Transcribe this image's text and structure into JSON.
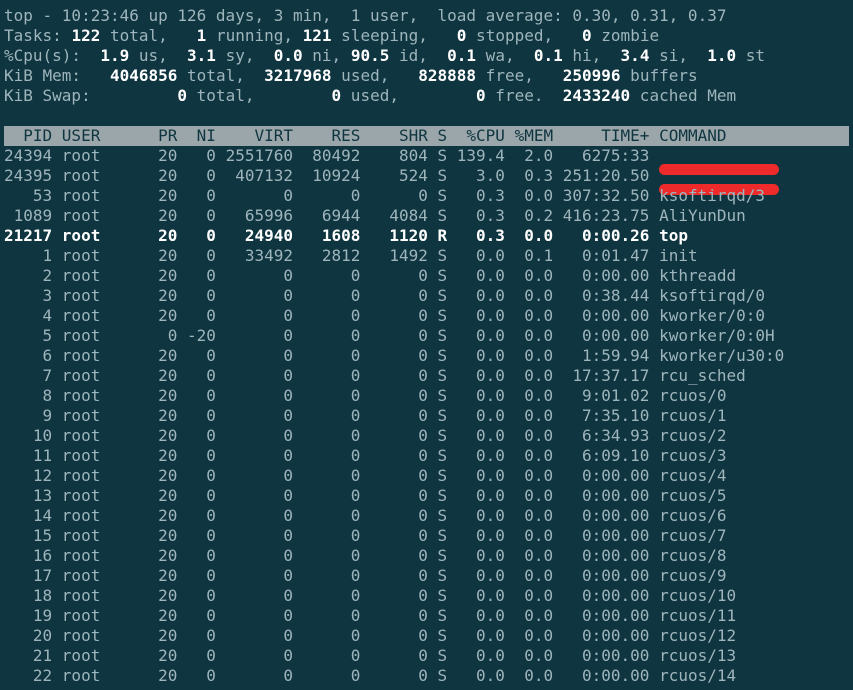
{
  "summary": {
    "line1": [
      {
        "t": "top - 10:23:46 up 126 days, 3 min,  1 user,  load average: 0.30, 0.31, 0.37",
        "b": false
      }
    ],
    "line2": [
      {
        "t": "Tasks: ",
        "b": false
      },
      {
        "t": "122",
        "b": true
      },
      {
        "t": " total,   ",
        "b": false
      },
      {
        "t": "1",
        "b": true
      },
      {
        "t": " running, ",
        "b": false
      },
      {
        "t": "121",
        "b": true
      },
      {
        "t": " sleeping,   ",
        "b": false
      },
      {
        "t": "0",
        "b": true
      },
      {
        "t": " stopped,   ",
        "b": false
      },
      {
        "t": "0",
        "b": true
      },
      {
        "t": " zombie",
        "b": false
      }
    ],
    "line3": [
      {
        "t": "%Cpu(s):  ",
        "b": false
      },
      {
        "t": "1.9",
        "b": true
      },
      {
        "t": " us,  ",
        "b": false
      },
      {
        "t": "3.1",
        "b": true
      },
      {
        "t": " sy,  ",
        "b": false
      },
      {
        "t": "0.0",
        "b": true
      },
      {
        "t": " ni, ",
        "b": false
      },
      {
        "t": "90.5",
        "b": true
      },
      {
        "t": " id,  ",
        "b": false
      },
      {
        "t": "0.1",
        "b": true
      },
      {
        "t": " wa,  ",
        "b": false
      },
      {
        "t": "0.1",
        "b": true
      },
      {
        "t": " hi,  ",
        "b": false
      },
      {
        "t": "3.4",
        "b": true
      },
      {
        "t": " si,  ",
        "b": false
      },
      {
        "t": "1.0",
        "b": true
      },
      {
        "t": " st",
        "b": false
      }
    ],
    "line4": [
      {
        "t": "KiB Mem:   ",
        "b": false
      },
      {
        "t": "4046856",
        "b": true
      },
      {
        "t": " total,  ",
        "b": false
      },
      {
        "t": "3217968",
        "b": true
      },
      {
        "t": " used,   ",
        "b": false
      },
      {
        "t": "828888",
        "b": true
      },
      {
        "t": " free,   ",
        "b": false
      },
      {
        "t": "250996",
        "b": true
      },
      {
        "t": " buffers",
        "b": false
      }
    ],
    "line5": [
      {
        "t": "KiB Swap:         ",
        "b": false
      },
      {
        "t": "0",
        "b": true
      },
      {
        "t": " total,        ",
        "b": false
      },
      {
        "t": "0",
        "b": true
      },
      {
        "t": " used,        ",
        "b": false
      },
      {
        "t": "0",
        "b": true
      },
      {
        "t": " free.  ",
        "b": false
      },
      {
        "t": "2433240",
        "b": true
      },
      {
        "t": " cached Mem",
        "b": false
      }
    ]
  },
  "columns": [
    {
      "key": "pid",
      "label": "PID",
      "w": 5,
      "align": "right"
    },
    {
      "key": "user",
      "label": "USER",
      "w": 9,
      "align": "left"
    },
    {
      "key": "pr",
      "label": "PR",
      "w": 2,
      "align": "right"
    },
    {
      "key": "ni",
      "label": "NI",
      "w": 3,
      "align": "right"
    },
    {
      "key": "virt",
      "label": "VIRT",
      "w": 7,
      "align": "right"
    },
    {
      "key": "res",
      "label": "RES",
      "w": 6,
      "align": "right"
    },
    {
      "key": "shr",
      "label": "SHR",
      "w": 6,
      "align": "right"
    },
    {
      "key": "s",
      "label": "S",
      "w": 1,
      "align": "left"
    },
    {
      "key": "cpu",
      "label": "%CPU",
      "w": 5,
      "align": "right"
    },
    {
      "key": "mem",
      "label": "%MEM",
      "w": 4,
      "align": "right"
    },
    {
      "key": "time",
      "label": "TIME+",
      "w": 9,
      "align": "right"
    },
    {
      "key": "command",
      "label": "COMMAND",
      "w": 16,
      "align": "left"
    }
  ],
  "processes": [
    {
      "pid": "24394",
      "user": "root",
      "pr": "20",
      "ni": "0",
      "virt": "2551760",
      "res": "80492",
      "shr": "804",
      "s": "S",
      "cpu": "139.4",
      "mem": "2.0",
      "time": "6275:33",
      "command": "",
      "redacted": true
    },
    {
      "pid": "24395",
      "user": "root",
      "pr": "20",
      "ni": "0",
      "virt": "407132",
      "res": "10924",
      "shr": "524",
      "s": "S",
      "cpu": "3.0",
      "mem": "0.3",
      "time": "251:20.50",
      "command": "",
      "redacted": true
    },
    {
      "pid": "53",
      "user": "root",
      "pr": "20",
      "ni": "0",
      "virt": "0",
      "res": "0",
      "shr": "0",
      "s": "S",
      "cpu": "0.3",
      "mem": "0.0",
      "time": "307:32.50",
      "command": "ksoftirqd/3"
    },
    {
      "pid": "1089",
      "user": "root",
      "pr": "20",
      "ni": "0",
      "virt": "65996",
      "res": "6944",
      "shr": "4084",
      "s": "S",
      "cpu": "0.3",
      "mem": "0.2",
      "time": "416:23.75",
      "command": "AliYunDun"
    },
    {
      "pid": "21217",
      "user": "root",
      "pr": "20",
      "ni": "0",
      "virt": "24940",
      "res": "1608",
      "shr": "1120",
      "s": "R",
      "cpu": "0.3",
      "mem": "0.0",
      "time": "0:00.26",
      "command": "top",
      "bold": true
    },
    {
      "pid": "1",
      "user": "root",
      "pr": "20",
      "ni": "0",
      "virt": "33492",
      "res": "2812",
      "shr": "1492",
      "s": "S",
      "cpu": "0.0",
      "mem": "0.1",
      "time": "0:01.47",
      "command": "init"
    },
    {
      "pid": "2",
      "user": "root",
      "pr": "20",
      "ni": "0",
      "virt": "0",
      "res": "0",
      "shr": "0",
      "s": "S",
      "cpu": "0.0",
      "mem": "0.0",
      "time": "0:00.00",
      "command": "kthreadd"
    },
    {
      "pid": "3",
      "user": "root",
      "pr": "20",
      "ni": "0",
      "virt": "0",
      "res": "0",
      "shr": "0",
      "s": "S",
      "cpu": "0.0",
      "mem": "0.0",
      "time": "0:38.44",
      "command": "ksoftirqd/0"
    },
    {
      "pid": "4",
      "user": "root",
      "pr": "20",
      "ni": "0",
      "virt": "0",
      "res": "0",
      "shr": "0",
      "s": "S",
      "cpu": "0.0",
      "mem": "0.0",
      "time": "0:00.00",
      "command": "kworker/0:0"
    },
    {
      "pid": "5",
      "user": "root",
      "pr": "0",
      "ni": "-20",
      "virt": "0",
      "res": "0",
      "shr": "0",
      "s": "S",
      "cpu": "0.0",
      "mem": "0.0",
      "time": "0:00.00",
      "command": "kworker/0:0H"
    },
    {
      "pid": "6",
      "user": "root",
      "pr": "20",
      "ni": "0",
      "virt": "0",
      "res": "0",
      "shr": "0",
      "s": "S",
      "cpu": "0.0",
      "mem": "0.0",
      "time": "1:59.94",
      "command": "kworker/u30:0"
    },
    {
      "pid": "7",
      "user": "root",
      "pr": "20",
      "ni": "0",
      "virt": "0",
      "res": "0",
      "shr": "0",
      "s": "S",
      "cpu": "0.0",
      "mem": "0.0",
      "time": "17:37.17",
      "command": "rcu_sched"
    },
    {
      "pid": "8",
      "user": "root",
      "pr": "20",
      "ni": "0",
      "virt": "0",
      "res": "0",
      "shr": "0",
      "s": "S",
      "cpu": "0.0",
      "mem": "0.0",
      "time": "9:01.02",
      "command": "rcuos/0"
    },
    {
      "pid": "9",
      "user": "root",
      "pr": "20",
      "ni": "0",
      "virt": "0",
      "res": "0",
      "shr": "0",
      "s": "S",
      "cpu": "0.0",
      "mem": "0.0",
      "time": "7:35.10",
      "command": "rcuos/1"
    },
    {
      "pid": "10",
      "user": "root",
      "pr": "20",
      "ni": "0",
      "virt": "0",
      "res": "0",
      "shr": "0",
      "s": "S",
      "cpu": "0.0",
      "mem": "0.0",
      "time": "6:34.93",
      "command": "rcuos/2"
    },
    {
      "pid": "11",
      "user": "root",
      "pr": "20",
      "ni": "0",
      "virt": "0",
      "res": "0",
      "shr": "0",
      "s": "S",
      "cpu": "0.0",
      "mem": "0.0",
      "time": "6:09.10",
      "command": "rcuos/3"
    },
    {
      "pid": "12",
      "user": "root",
      "pr": "20",
      "ni": "0",
      "virt": "0",
      "res": "0",
      "shr": "0",
      "s": "S",
      "cpu": "0.0",
      "mem": "0.0",
      "time": "0:00.00",
      "command": "rcuos/4"
    },
    {
      "pid": "13",
      "user": "root",
      "pr": "20",
      "ni": "0",
      "virt": "0",
      "res": "0",
      "shr": "0",
      "s": "S",
      "cpu": "0.0",
      "mem": "0.0",
      "time": "0:00.00",
      "command": "rcuos/5"
    },
    {
      "pid": "14",
      "user": "root",
      "pr": "20",
      "ni": "0",
      "virt": "0",
      "res": "0",
      "shr": "0",
      "s": "S",
      "cpu": "0.0",
      "mem": "0.0",
      "time": "0:00.00",
      "command": "rcuos/6"
    },
    {
      "pid": "15",
      "user": "root",
      "pr": "20",
      "ni": "0",
      "virt": "0",
      "res": "0",
      "shr": "0",
      "s": "S",
      "cpu": "0.0",
      "mem": "0.0",
      "time": "0:00.00",
      "command": "rcuos/7"
    },
    {
      "pid": "16",
      "user": "root",
      "pr": "20",
      "ni": "0",
      "virt": "0",
      "res": "0",
      "shr": "0",
      "s": "S",
      "cpu": "0.0",
      "mem": "0.0",
      "time": "0:00.00",
      "command": "rcuos/8"
    },
    {
      "pid": "17",
      "user": "root",
      "pr": "20",
      "ni": "0",
      "virt": "0",
      "res": "0",
      "shr": "0",
      "s": "S",
      "cpu": "0.0",
      "mem": "0.0",
      "time": "0:00.00",
      "command": "rcuos/9"
    },
    {
      "pid": "18",
      "user": "root",
      "pr": "20",
      "ni": "0",
      "virt": "0",
      "res": "0",
      "shr": "0",
      "s": "S",
      "cpu": "0.0",
      "mem": "0.0",
      "time": "0:00.00",
      "command": "rcuos/10"
    },
    {
      "pid": "19",
      "user": "root",
      "pr": "20",
      "ni": "0",
      "virt": "0",
      "res": "0",
      "shr": "0",
      "s": "S",
      "cpu": "0.0",
      "mem": "0.0",
      "time": "0:00.00",
      "command": "rcuos/11"
    },
    {
      "pid": "20",
      "user": "root",
      "pr": "20",
      "ni": "0",
      "virt": "0",
      "res": "0",
      "shr": "0",
      "s": "S",
      "cpu": "0.0",
      "mem": "0.0",
      "time": "0:00.00",
      "command": "rcuos/12"
    },
    {
      "pid": "21",
      "user": "root",
      "pr": "20",
      "ni": "0",
      "virt": "0",
      "res": "0",
      "shr": "0",
      "s": "S",
      "cpu": "0.0",
      "mem": "0.0",
      "time": "0:00.00",
      "command": "rcuos/13"
    },
    {
      "pid": "22",
      "user": "root",
      "pr": "20",
      "ni": "0",
      "virt": "0",
      "res": "0",
      "shr": "0",
      "s": "S",
      "cpu": "0.0",
      "mem": "0.0",
      "time": "0:00.00",
      "command": "rcuos/14"
    }
  ],
  "colors": {
    "background": "#0f3540",
    "text": "#9eb5bb",
    "bold_text": "#ffffff",
    "header_bar": "#9aa6a9",
    "redaction": "#ef2a2a"
  }
}
